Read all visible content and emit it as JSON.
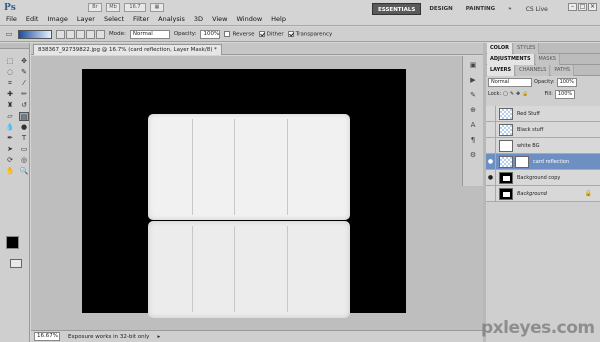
{
  "menubar": {
    "logo": "Ps",
    "items": [
      "File",
      "Edit",
      "Image",
      "Layer",
      "Select",
      "Filter",
      "Analysis",
      "3D",
      "View",
      "Window",
      "Help"
    ],
    "zoom_display": "16.7",
    "workspaces": [
      "ESSENTIALS",
      "DESIGN",
      "PAINTING",
      "»"
    ],
    "cs_live": "CS Live"
  },
  "options_bar": {
    "mode_label": "Mode:",
    "mode_value": "Normal",
    "opacity_label": "Opacity:",
    "opacity_value": "100%",
    "reverse_label": "Reverse",
    "dither_label": "Dither",
    "transparency_label": "Transparency"
  },
  "document": {
    "tab_title": "838367_92739822.jpg @ 16.7% (card reflection, Layer Mask/8) *"
  },
  "status_bar": {
    "zoom": "16.67%",
    "message": "Exposure works in 32-bit only"
  },
  "panels": {
    "top_tabs": [
      "COLOR",
      "STYLES"
    ],
    "mid_tabs": [
      "ADJUSTMENTS",
      "MASKS"
    ],
    "layer_tabs": [
      "LAYERS",
      "CHANNELS",
      "PATHS"
    ],
    "blend_mode": "Normal",
    "opacity_label": "Opacity:",
    "opacity_value": "100%",
    "lock_label": "Lock:",
    "fill_label": "Fill:",
    "fill_value": "100%"
  },
  "layers": [
    {
      "name": "Red Stuff",
      "visible": false,
      "thumb": "checker",
      "active": false
    },
    {
      "name": "Black stuff",
      "visible": false,
      "thumb": "checker",
      "active": false
    },
    {
      "name": "white BG",
      "visible": false,
      "thumb": "white",
      "active": false
    },
    {
      "name": "card reflection",
      "visible": true,
      "thumb": "checker",
      "active": true
    },
    {
      "name": "Background copy",
      "visible": true,
      "thumb": "black",
      "active": false
    },
    {
      "name": "Background",
      "visible": false,
      "thumb": "black",
      "active": false
    }
  ],
  "watermark": "pxleyes.com"
}
